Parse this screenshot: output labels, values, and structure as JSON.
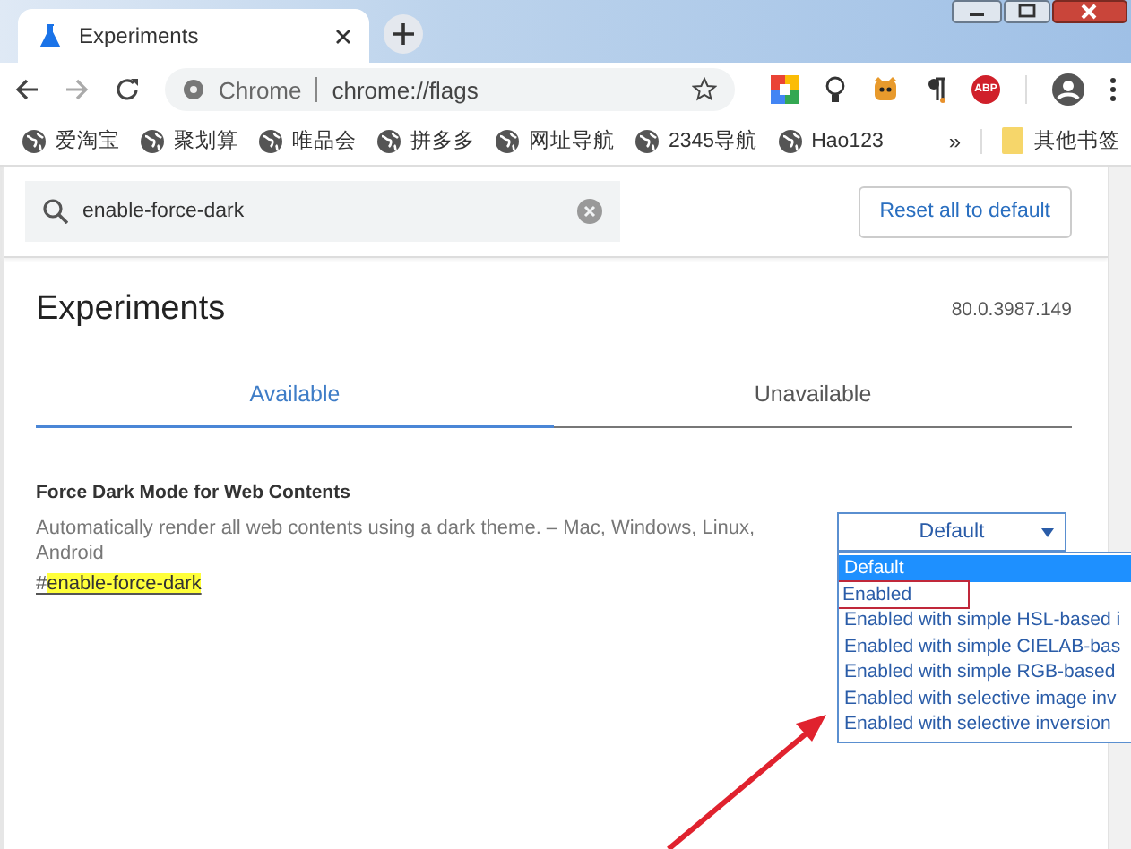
{
  "tabs": [
    {
      "title": "Experiments",
      "selected": true
    }
  ],
  "address_bar": {
    "site": "Chrome",
    "url": "chrome://flags"
  },
  "extensions": [
    {
      "kind": "grid"
    },
    {
      "kind": "bulb"
    },
    {
      "kind": "creature"
    },
    {
      "kind": "pilcrow"
    },
    {
      "kind": "adblock",
      "label": "ABP"
    }
  ],
  "bookmarks": [
    {
      "label": "爱淘宝"
    },
    {
      "label": "聚划算"
    },
    {
      "label": "唯品会"
    },
    {
      "label": "拼多多"
    },
    {
      "label": "网址导航"
    },
    {
      "label": "2345导航"
    },
    {
      "label": "Hao123"
    }
  ],
  "bookmarks_overflow": "»",
  "other_bookmarks": "其他书签",
  "search": {
    "value": "enable-force-dark"
  },
  "reset_button": "Reset all to default",
  "heading": "Experiments",
  "version": "80.0.3987.149",
  "page_tabs": [
    {
      "label": "Available",
      "selected": true
    },
    {
      "label": "Unavailable",
      "selected": false
    }
  ],
  "flag": {
    "title": "Force Dark Mode for Web Contents",
    "description": "Automatically render all web contents using a dark theme. – Mac, Windows, Linux, Android",
    "link_prefix": "#",
    "link_match": "enable-force-dark",
    "select_value": "Default",
    "options": [
      {
        "label": "Default",
        "selected": true,
        "highlighted": false
      },
      {
        "label": "Enabled",
        "selected": false,
        "highlighted": true
      },
      {
        "label": "Enabled with simple HSL-based i",
        "selected": false,
        "highlighted": false
      },
      {
        "label": "Enabled with simple CIELAB-bas",
        "selected": false,
        "highlighted": false
      },
      {
        "label": "Enabled with simple RGB-based",
        "selected": false,
        "highlighted": false
      },
      {
        "label": "Enabled with selective image inv",
        "selected": false,
        "highlighted": false
      },
      {
        "label": "Enabled with selective inversion",
        "selected": false,
        "highlighted": false
      }
    ]
  }
}
